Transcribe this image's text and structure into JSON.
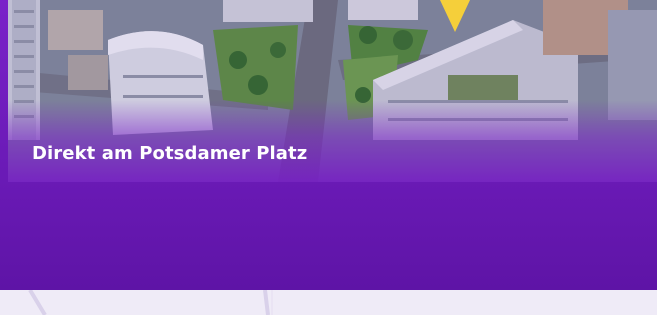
{
  "hero": {
    "headline": "Direkt am Potsdamer Platz",
    "image_subject": "aerial-city-view"
  },
  "icons": {
    "location_marker": "map-pin-icon"
  },
  "colors": {
    "hero_purple": "#6a1ab6",
    "pin_yellow": "#f5cf3a",
    "strip_background": "#efebf7"
  }
}
